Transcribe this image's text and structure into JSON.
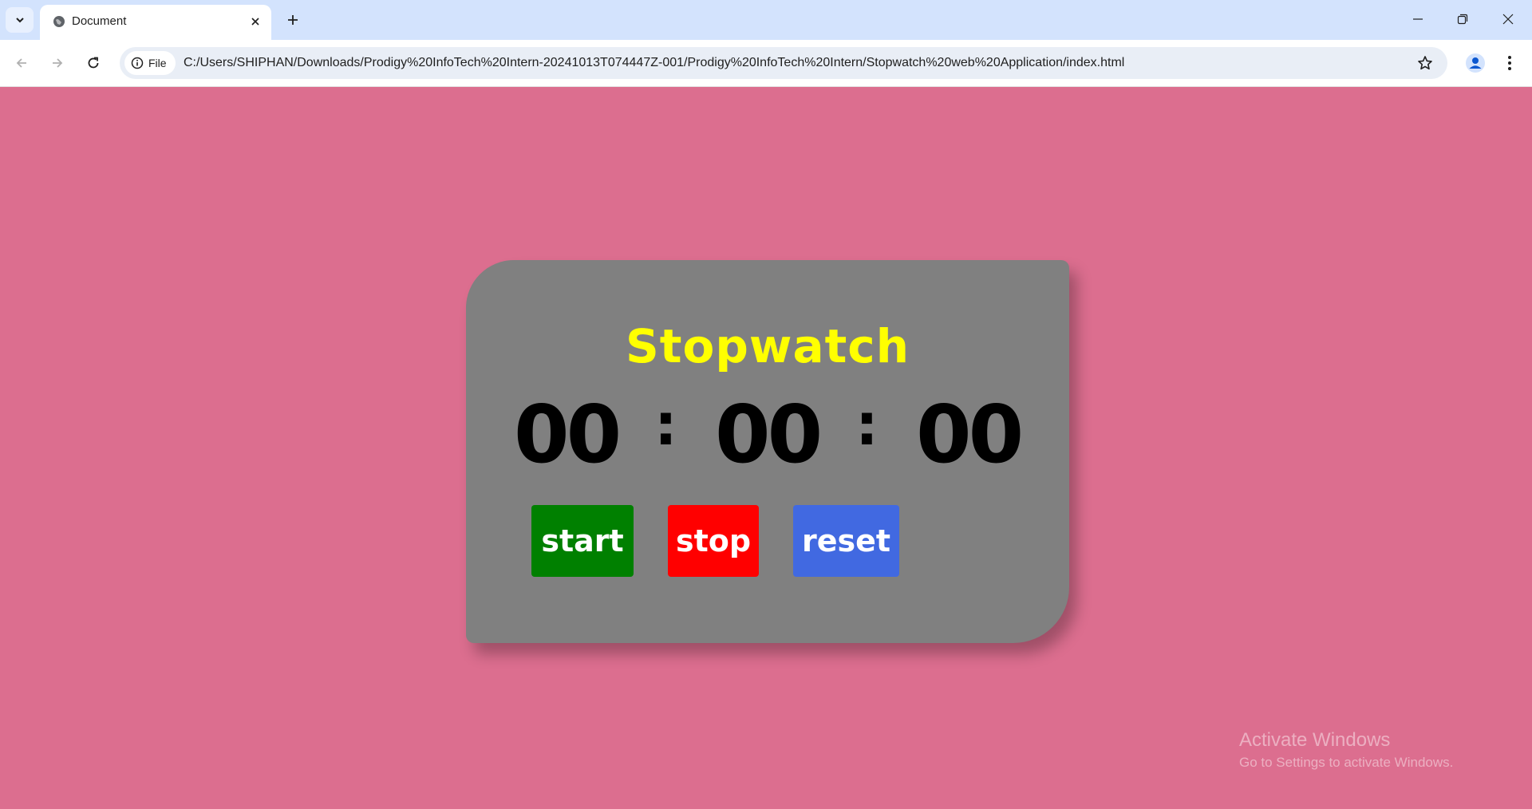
{
  "browser": {
    "tab": {
      "title": "Document"
    },
    "address": {
      "chip_label": "File",
      "url": "C:/Users/SHIPHAN/Downloads/Prodigy%20InfoTech%20Intern-20241013T074447Z-001/Prodigy%20InfoTech%20Intern/Stopwatch%20web%20Application/index.html"
    },
    "icons": {
      "tab_search": "chevron-down-icon",
      "favicon": "globe-icon",
      "tab_close": "close-icon",
      "new_tab": "plus-icon",
      "back": "arrow-left-icon",
      "forward": "arrow-right-icon",
      "reload": "reload-icon",
      "site_info": "info-icon",
      "bookmark": "star-icon",
      "profile": "person-icon",
      "menu": "kebab-menu-icon"
    }
  },
  "stopwatch": {
    "title": "Stopwatch",
    "hours": "00",
    "minutes": "00",
    "seconds": "00",
    "separator": ":",
    "buttons": {
      "start": "start",
      "stop": "stop",
      "reset": "reset"
    }
  },
  "colors": {
    "page_background": "#dc6e8f",
    "card_background": "#808080",
    "title": "#ffff00",
    "start_button": "#008000",
    "stop_button": "#ff0000",
    "reset_button": "#4169e1"
  },
  "watermark": {
    "title": "Activate Windows",
    "subtitle": "Go to Settings to activate Windows."
  }
}
